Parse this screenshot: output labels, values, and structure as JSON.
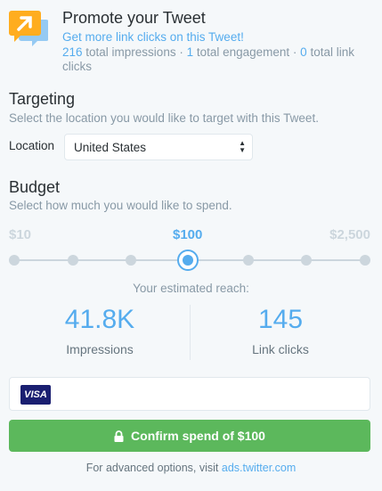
{
  "promote": {
    "title": "Promote your Tweet",
    "subtitle": "Get more link clicks on this Tweet!",
    "impressions_count": "216",
    "impressions_text": " total impressions · ",
    "engagement_count": "1",
    "engagement_text": " total engagement · ",
    "clicks_count": "0",
    "clicks_text": " total link clicks"
  },
  "targeting": {
    "title": "Targeting",
    "description": "Select the location you would like to target with this Tweet.",
    "location_label": "Location",
    "location_value": "United States"
  },
  "budget": {
    "title": "Budget",
    "description": "Select how much you would like to spend.",
    "min_label": "$10",
    "current_label": "$100",
    "max_label": "$2,500",
    "slider_steps": 7,
    "slider_selected_index": 3
  },
  "reach": {
    "label": "Your estimated reach:",
    "impressions_value": "41.8K",
    "impressions_caption": "Impressions",
    "clicks_value": "145",
    "clicks_caption": "Link clicks"
  },
  "payment": {
    "card_brand": "VISA"
  },
  "confirm": {
    "label": "Confirm spend of $100"
  },
  "footer": {
    "text": "For advanced options, visit ",
    "link": "ads.twitter.com"
  },
  "colors": {
    "accent": "#55acee",
    "confirm": "#5cb85c",
    "icon_orange": "#ffad1f",
    "icon_blue": "#55acee"
  }
}
